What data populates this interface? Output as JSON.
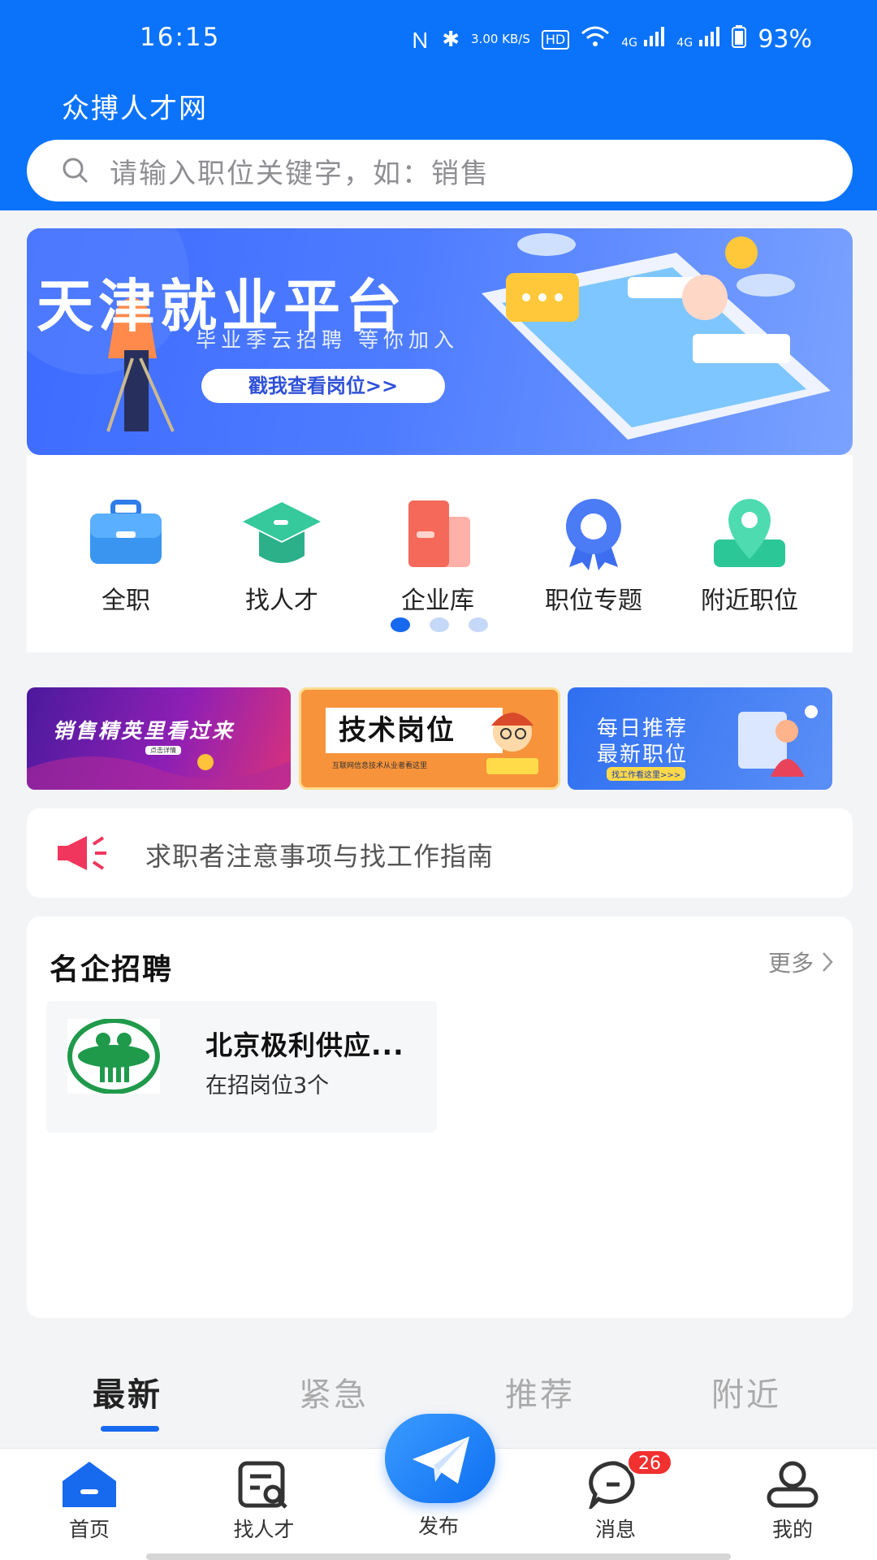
{
  "status_bar": {
    "time": "16:15",
    "speed": "3.00 KB/S",
    "hd": "HD",
    "network1": "4G",
    "network2": "4G",
    "battery": "93%"
  },
  "app_title": "众搏人才网",
  "search": {
    "placeholder": "请输入职位关键字，如：销售"
  },
  "banner": {
    "title": "天津就业平台",
    "subtitle": "毕业季云招聘 等你加入",
    "cta": "戳我查看岗位>>"
  },
  "categories": [
    {
      "label": "全职",
      "icon": "briefcase-icon"
    },
    {
      "label": "找人才",
      "icon": "graduation-cap-icon"
    },
    {
      "label": "企业库",
      "icon": "company-icon"
    },
    {
      "label": "职位专题",
      "icon": "badge-icon"
    },
    {
      "label": "附近职位",
      "icon": "location-pin-icon"
    }
  ],
  "carousel": {
    "pages": 3,
    "active": 1
  },
  "promos": [
    {
      "title": "销售精英里看过来",
      "sub": "点击详情"
    },
    {
      "title": "技术岗位",
      "sub": "互联网信息技术从业者看这里"
    },
    {
      "title": "每日推荐",
      "title2": "最新职位",
      "sub": "找工作看这里>>>"
    }
  ],
  "notice": {
    "text": "求职者注意事项与找工作指南"
  },
  "famous": {
    "heading": "名企招聘",
    "more": "更多",
    "companies": [
      {
        "name": "北京极利供应...",
        "count": "在招岗位3个"
      }
    ]
  },
  "tabs": [
    "最新",
    "紧急",
    "推荐",
    "附近"
  ],
  "active_tab": "最新",
  "bottom_nav": [
    {
      "label": "首页",
      "icon": "home-icon"
    },
    {
      "label": "找人才",
      "icon": "find-talent-icon"
    },
    {
      "label": "发布",
      "icon": "paper-plane-icon"
    },
    {
      "label": "消息",
      "icon": "message-icon"
    },
    {
      "label": "我的",
      "icon": "user-icon"
    }
  ],
  "messages_badge": "26",
  "colors": {
    "primary": "#0b73fa",
    "accent": "#1769ee",
    "badge": "#f23030",
    "alert": "#f0365c"
  }
}
